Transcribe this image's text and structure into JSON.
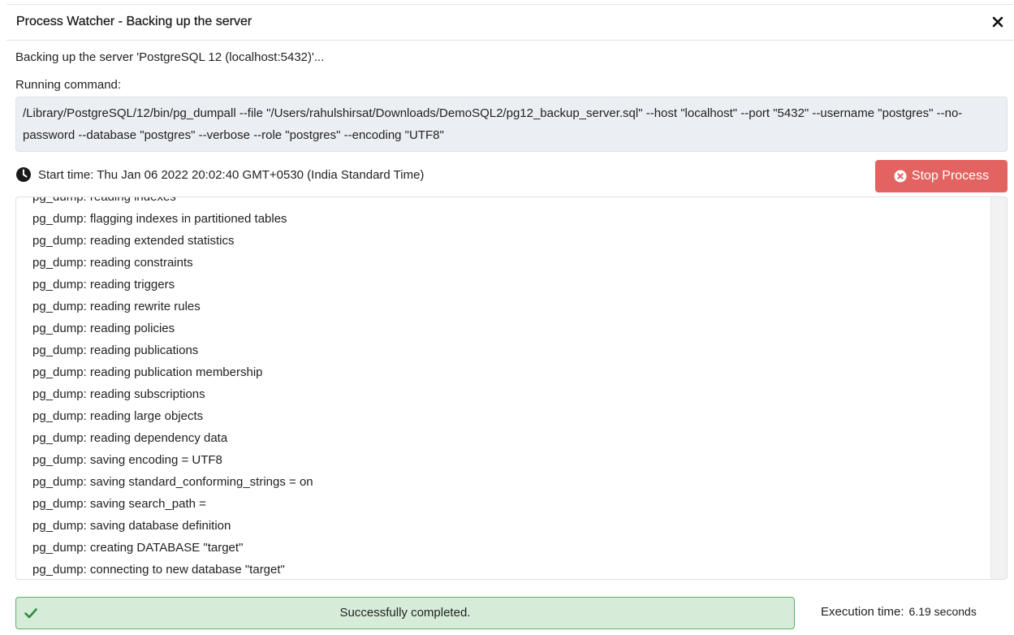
{
  "dialog": {
    "title": "Process Watcher - Backing up the server",
    "close_icon": "close-icon"
  },
  "message": "Backing up the server 'PostgreSQL 12 (localhost:5432)'...",
  "running_label": "Running command:",
  "command": "/Library/PostgreSQL/12/bin/pg_dumpall --file \"/Users/rahulshirsat/Downloads/DemoSQL2/pg12_backup_server.sql\" --host \"localhost\" --port \"5432\" --username \"postgres\" --no-password --database \"postgres\" --verbose --role \"postgres\" --encoding \"UTF8\"",
  "start_time": {
    "icon": "clock-icon",
    "text": "Start time: Thu Jan 06 2022 20:02:40 GMT+0530 (India Standard Time)"
  },
  "stop_button": {
    "icon": "times-circle-icon",
    "label": "Stop Process",
    "color": "#e36361"
  },
  "log": [
    "pg_dump: reading indexes",
    "pg_dump: flagging indexes in partitioned tables",
    "pg_dump: reading extended statistics",
    "pg_dump: reading constraints",
    "pg_dump: reading triggers",
    "pg_dump: reading rewrite rules",
    "pg_dump: reading policies",
    "pg_dump: reading publications",
    "pg_dump: reading publication membership",
    "pg_dump: reading subscriptions",
    "pg_dump: reading large objects",
    "pg_dump: reading dependency data",
    "pg_dump: saving encoding = UTF8",
    "pg_dump: saving standard_conforming_strings = on",
    "pg_dump: saving search_path =",
    "pg_dump: saving database definition",
    "pg_dump: creating DATABASE \"target\"",
    "pg_dump: connecting to new database \"target\""
  ],
  "status": {
    "icon": "check-icon",
    "text": "Successfully completed.",
    "color": "#5cb46a"
  },
  "execution": {
    "label": "Execution time:",
    "value": "6.19 seconds"
  }
}
